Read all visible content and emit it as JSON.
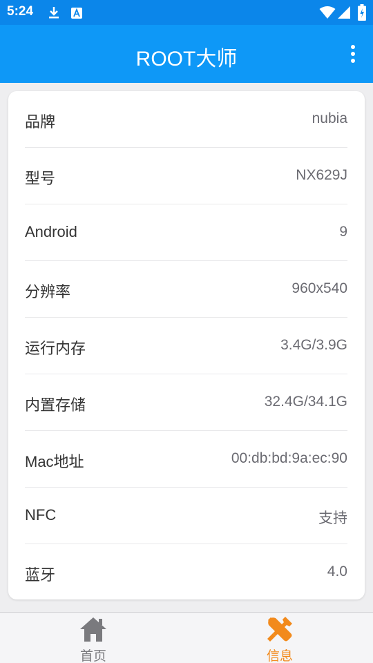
{
  "status_bar": {
    "time": "5:24"
  },
  "app_bar": {
    "title": "ROOT大师"
  },
  "info_rows": [
    {
      "label": "品牌",
      "value": "nubia"
    },
    {
      "label": "型号",
      "value": "NX629J"
    },
    {
      "label": "Android",
      "value": "9"
    },
    {
      "label": "分辨率",
      "value": "960x540"
    },
    {
      "label": "运行内存",
      "value": "3.4G/3.9G"
    },
    {
      "label": "内置存储",
      "value": "32.4G/34.1G"
    },
    {
      "label": "Mac地址",
      "value": "00:db:bd:9a:ec:90"
    },
    {
      "label": "NFC",
      "value": "支持"
    },
    {
      "label": "蓝牙",
      "value": "4.0"
    }
  ],
  "bottom_nav": {
    "items": [
      {
        "label": "首页",
        "icon": "home-icon",
        "active": false
      },
      {
        "label": "信息",
        "icon": "tools-icon",
        "active": true
      }
    ]
  },
  "colors": {
    "status_bar": "#0b86ea",
    "app_bar": "#0e98f7",
    "nav_active": "#f28a1c",
    "nav_inactive": "#7a7a7e"
  }
}
